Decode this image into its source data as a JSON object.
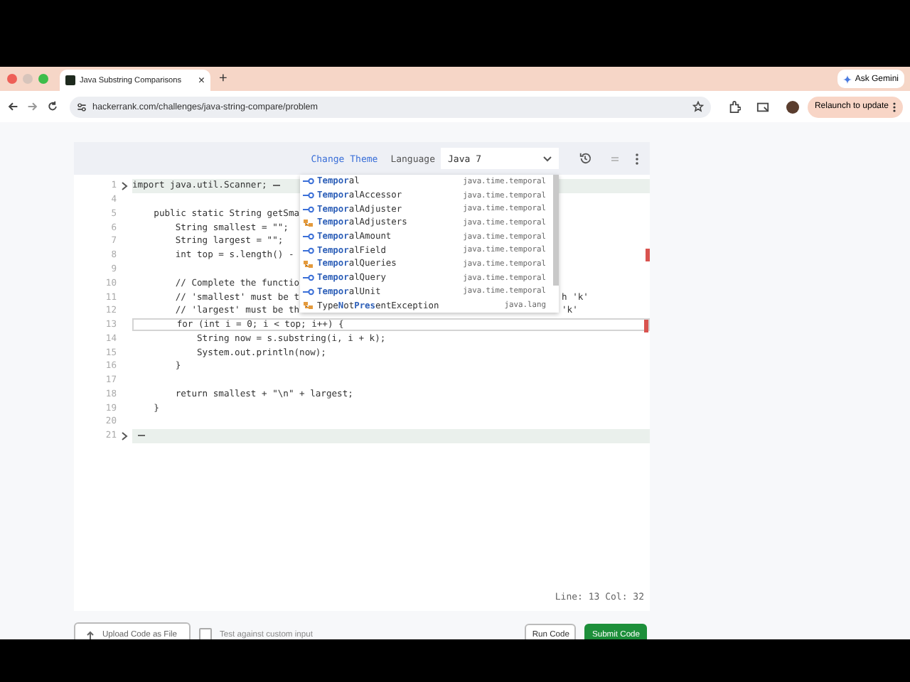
{
  "browser": {
    "tab_title": "Java Substring Comparisons",
    "tab_close": "×",
    "new_tab": "+",
    "gemini_button": "Ask Gemini",
    "url": "hackerrank.com/challenges/java-string-compare/problem",
    "relaunch_button": "Relaunch to update"
  },
  "editor_toolbar": {
    "change_theme": "Change Theme",
    "language_label": "Language",
    "language": "Java 7"
  },
  "code_lines": [
    {
      "number": "1",
      "text": "import java.util.Scanner;",
      "folded": true,
      "active": false,
      "error": false
    },
    {
      "number": "4",
      "folded": false,
      "active": false,
      "error": false
    },
    {
      "number": "5",
      "text": "    public static String getSma",
      "folded": false,
      "active": false,
      "error": false
    },
    {
      "number": "6",
      "text": "        String smallest = \"\";",
      "folded": false,
      "active": false,
      "error": false
    },
    {
      "number": "7",
      "text": "        String largest = \"\";",
      "folded": false,
      "active": false,
      "error": false
    },
    {
      "number": "8",
      "text": "        int top = s.length() -",
      "folded": false,
      "active": false,
      "error": true
    },
    {
      "number": "9",
      "folded": false,
      "active": false,
      "error": false
    },
    {
      "number": "10",
      "text": "        // Complete the functio",
      "folded": false,
      "active": false,
      "error": false
    },
    {
      "number": "11",
      "text": "        // 'smallest' must be t",
      "tail": "h 'k'",
      "folded": false,
      "active": false,
      "error": false
    },
    {
      "number": "12",
      "text": "        // 'largest' must be th",
      "tail": "'k'",
      "folded": false,
      "active": false,
      "error": false
    },
    {
      "number": "13",
      "text": "        for (int i = 0; i < top; i++) {",
      "folded": false,
      "active": true,
      "error": true
    },
    {
      "number": "14",
      "text": "            String now = s.substring(i, i + k);",
      "folded": false,
      "active": false,
      "error": false
    },
    {
      "number": "15",
      "text": "            System.out.println(now);",
      "folded": false,
      "active": false,
      "error": false
    },
    {
      "number": "16",
      "text": "        }",
      "folded": false,
      "active": false,
      "error": false
    },
    {
      "number": "17",
      "folded": false,
      "active": false,
      "error": false
    },
    {
      "number": "18",
      "text": "        return smallest + \"\\n\" + largest;",
      "folded": false,
      "active": false,
      "error": false
    },
    {
      "number": "19",
      "text": "    }",
      "folded": false,
      "active": false,
      "error": false
    },
    {
      "number": "20",
      "folded": false,
      "active": false,
      "error": false
    },
    {
      "number": "21",
      "folded": true,
      "active": false,
      "error": false
    }
  ],
  "autocomplete": [
    {
      "label": "**Tempor**al",
      "package": "java.time.temporal",
      "kind": "interface"
    },
    {
      "label": "**Tempor**alAccessor",
      "package": "java.time.temporal",
      "kind": "interface"
    },
    {
      "label": "**Tempor**alAdjuster",
      "package": "java.time.temporal",
      "kind": "interface"
    },
    {
      "label": "**Tempor**alAdjusters",
      "package": "java.time.temporal",
      "kind": "class"
    },
    {
      "label": "**Tempor**alAmount",
      "package": "java.time.temporal",
      "kind": "interface"
    },
    {
      "label": "**Tempor**alField",
      "package": "java.time.temporal",
      "kind": "interface"
    },
    {
      "label": "**Tempor**alQueries",
      "package": "java.time.temporal",
      "kind": "class"
    },
    {
      "label": "**Tempor**alQuery",
      "package": "java.time.temporal",
      "kind": "interface"
    },
    {
      "label": "**Tempor**alUnit",
      "package": "java.time.temporal",
      "kind": "interface"
    },
    {
      "label": "Type**N**ot**Pres**entException",
      "package": "java.lang",
      "kind": "class"
    }
  ],
  "status": "Line: 13 Col: 32",
  "footer": {
    "upload_button": "Upload Code as File",
    "custom_input": {
      "label": "Test against custom input",
      "checked": false
    },
    "run_button": "Run Code",
    "submit_button": "Submit Code"
  }
}
